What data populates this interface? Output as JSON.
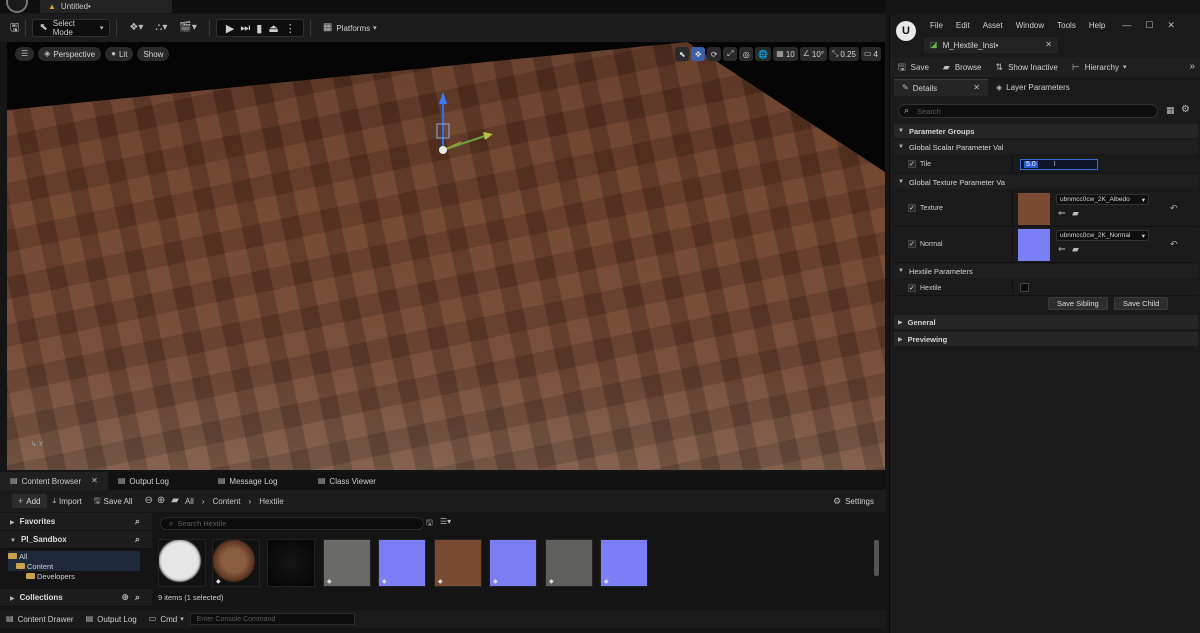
{
  "window": {
    "doc_tab": "Untitled•"
  },
  "toolbar": {
    "select_mode": "Select Mode",
    "platforms": "Platforms"
  },
  "viewport": {
    "perspective": "Perspective",
    "lit": "Lit",
    "show": "Show",
    "grid_size": "10",
    "rotation_snap": "10°",
    "scale_snap": "0.25",
    "camera_speed": "4",
    "axis": "Y"
  },
  "bottom_tabs": [
    "Content Browser",
    "Output Log",
    "Message Log",
    "Class Viewer"
  ],
  "content_browser": {
    "add": "Add",
    "import": "Import",
    "save_all": "Save All",
    "breadcrumb": [
      "All",
      "Content",
      "Hextile"
    ],
    "settings": "Settings",
    "favorites": "Favorites",
    "project": "PI_Sandbox",
    "tree": [
      "All",
      "Content",
      "Developers"
    ],
    "collections": "Collections",
    "search_placeholder": "Search Hextile",
    "item_count": "9 items (1 selected)"
  },
  "statusbar": {
    "content_drawer": "Content Drawer",
    "output_log": "Output Log",
    "cmd": "Cmd",
    "console_placeholder": "Enter Console Command"
  },
  "editor": {
    "menu": [
      "File",
      "Edit",
      "Asset",
      "Window",
      "Tools",
      "Help"
    ],
    "asset_tab": "M_Hextile_Inst•",
    "toolbar": {
      "save": "Save",
      "browse": "Browse",
      "show_inactive": "Show Inactive",
      "hierarchy": "Hierarchy"
    },
    "tabs": [
      "Details",
      "Layer Parameters"
    ],
    "search_placeholder": "Search",
    "sections": {
      "parameter_groups": "Parameter Groups",
      "global_scalar": "Global Scalar Parameter Val",
      "global_texture": "Global Texture Parameter Va",
      "hextile_params": "Hextile Parameters",
      "general": "General",
      "previewing": "Previewing"
    },
    "params": {
      "tile_label": "Tile",
      "tile_value": "5.0",
      "texture_label": "Texture",
      "texture_value": "ubnmcc0cw_2K_Albedo",
      "normal_label": "Normal",
      "normal_value": "ubnmcc0cw_2K_Normal",
      "hextile_label": "Hextile"
    },
    "save_sibling": "Save Sibling",
    "save_child": "Save Child"
  }
}
